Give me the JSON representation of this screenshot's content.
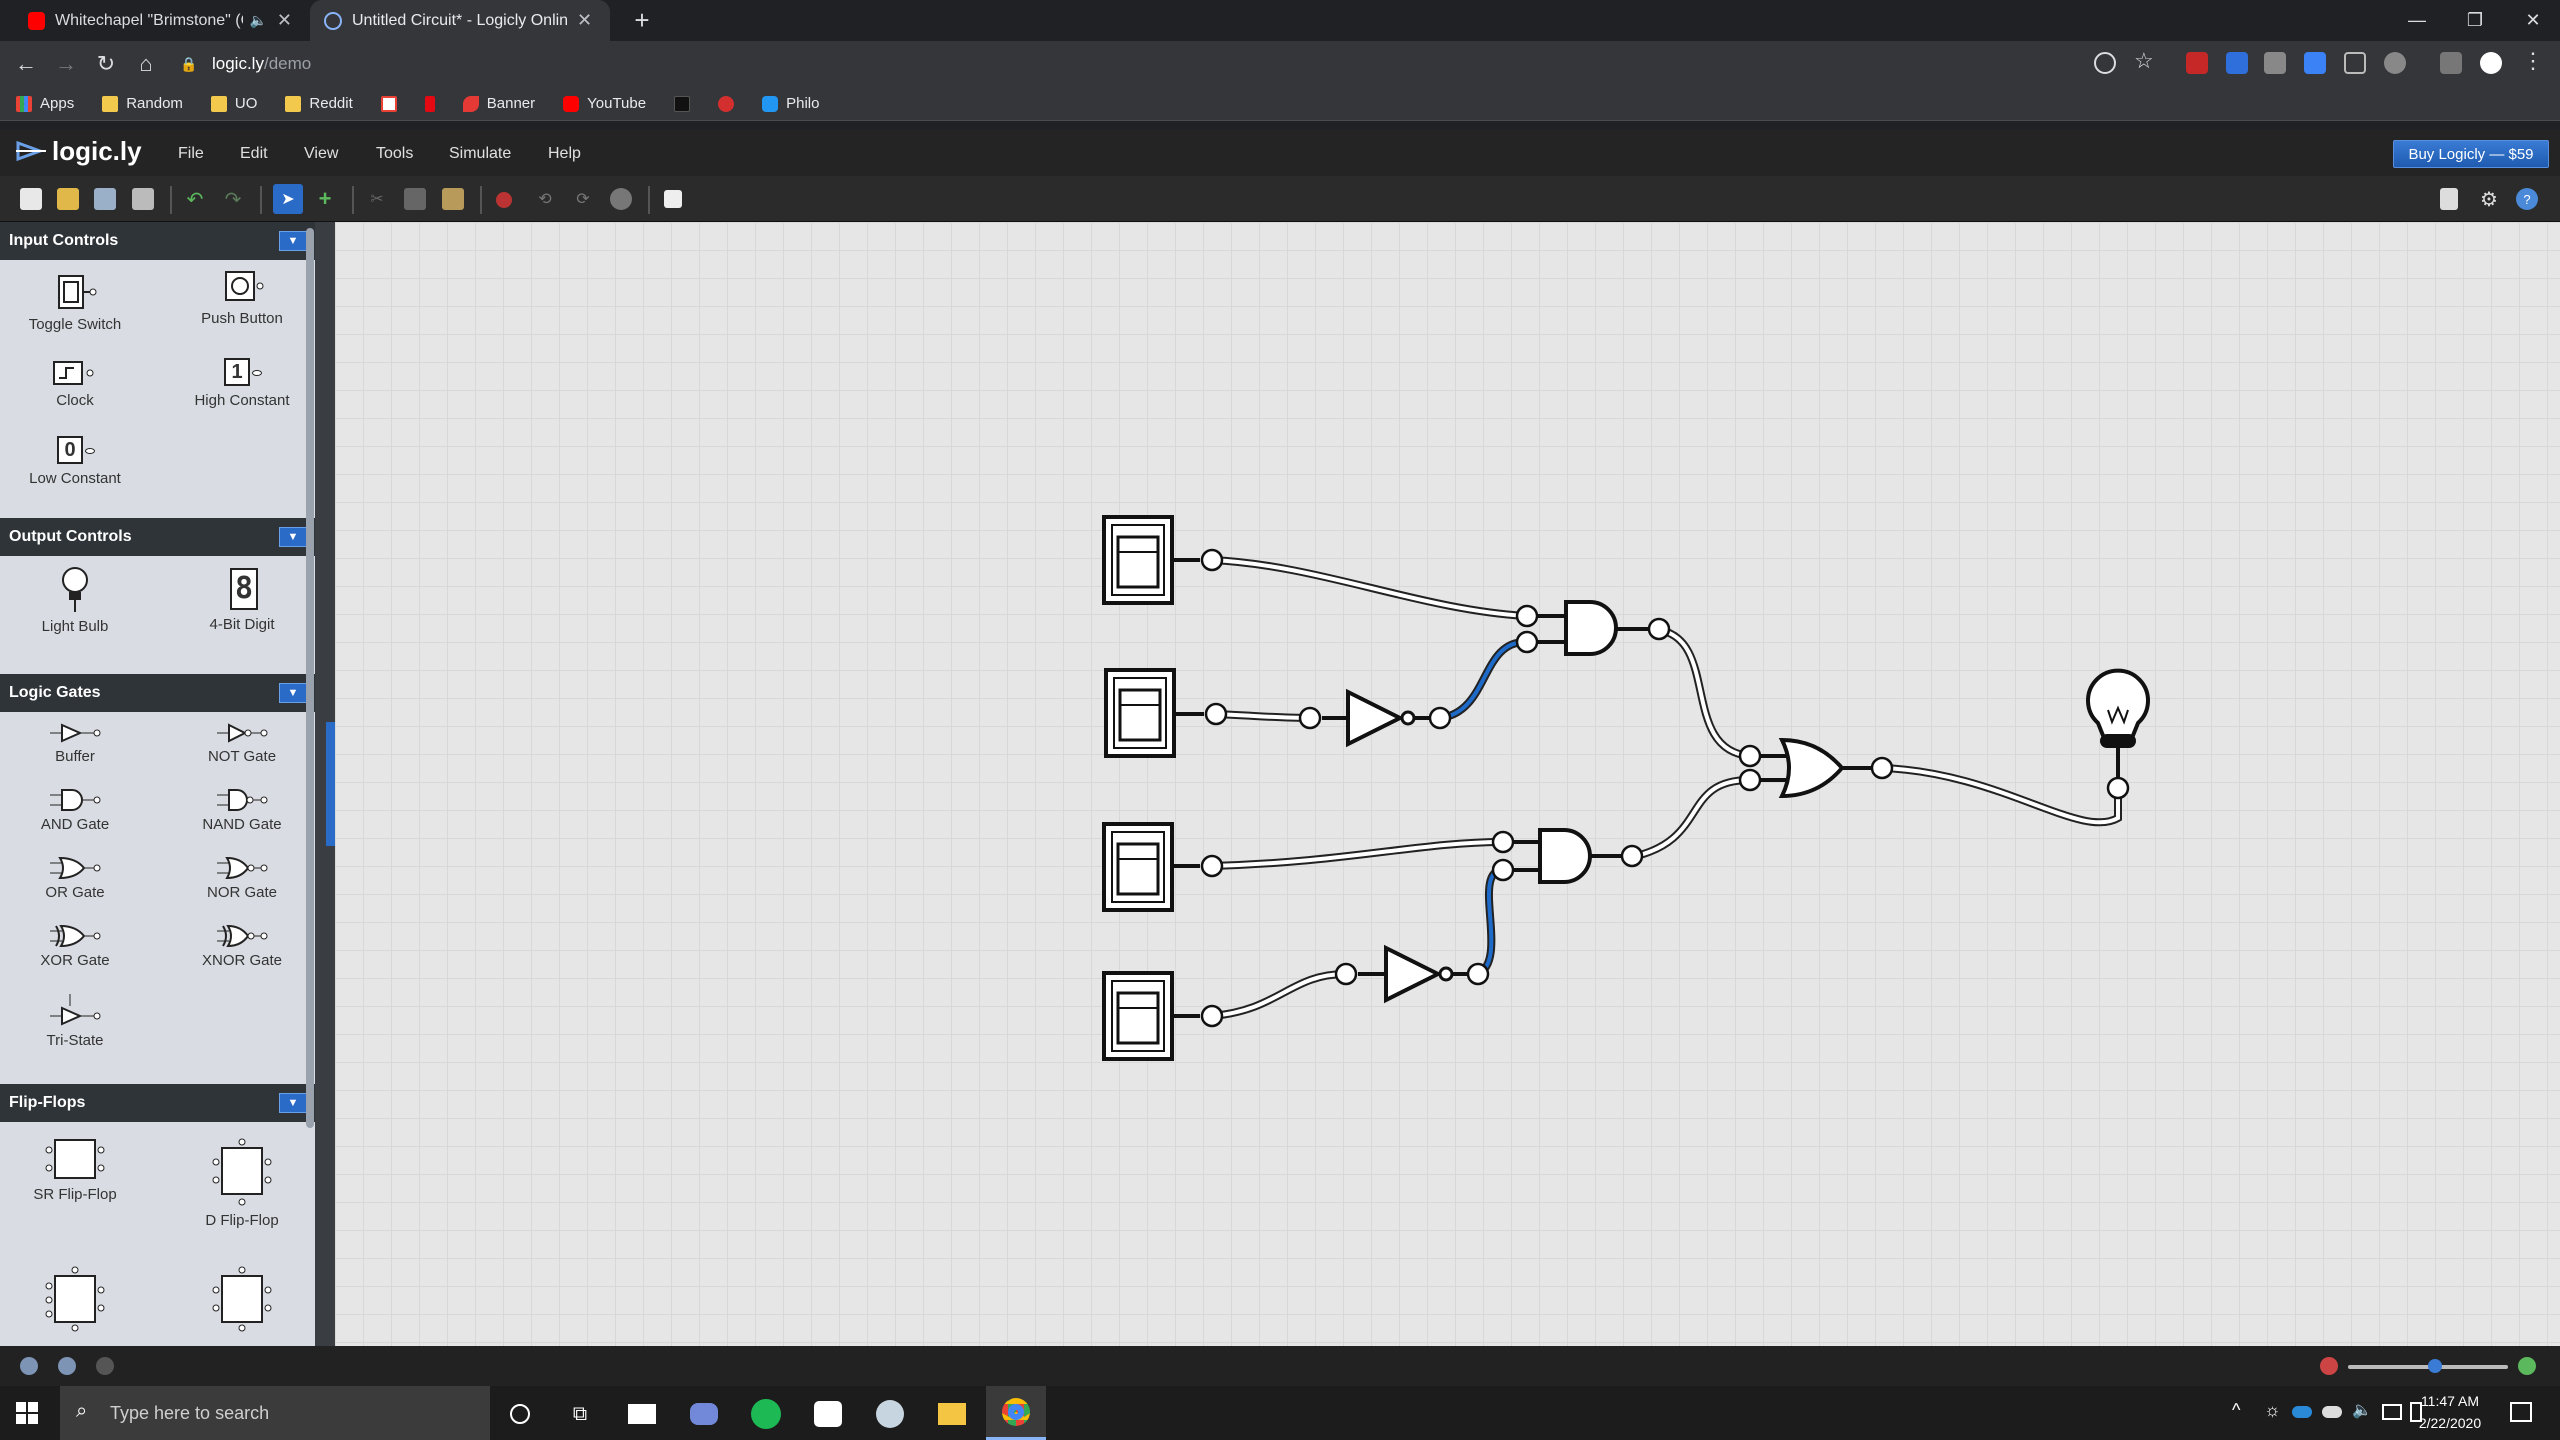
{
  "browser": {
    "tabs": [
      {
        "title": "Whitechapel \"Brimstone\" (OF",
        "active": false
      },
      {
        "title": "Untitled Circuit* - Logicly Online",
        "active": true
      }
    ],
    "url_domain": "logic.ly",
    "url_path": "/demo",
    "bookmarks": [
      "Apps",
      "Random",
      "UO",
      "Reddit",
      "Banner",
      "YouTube",
      "Philo"
    ]
  },
  "app": {
    "logo": "logic.ly",
    "menu": [
      "File",
      "Edit",
      "View",
      "Tools",
      "Simulate",
      "Help"
    ],
    "buy_label": "Buy Logicly — $59"
  },
  "sidebar": {
    "input_controls": {
      "title": "Input Controls",
      "items": [
        "Toggle Switch",
        "Push Button",
        "Clock",
        "High Constant",
        "Low Constant"
      ],
      "high_glyph": "1",
      "low_glyph": "0"
    },
    "output_controls": {
      "title": "Output Controls",
      "items": [
        "Light Bulb",
        "4-Bit Digit"
      ],
      "digit_glyph": "8"
    },
    "logic_gates": {
      "title": "Logic Gates",
      "items": [
        "Buffer",
        "NOT Gate",
        "AND Gate",
        "NAND Gate",
        "OR Gate",
        "NOR Gate",
        "XOR Gate",
        "XNOR Gate",
        "Tri-State"
      ]
    },
    "flip_flops": {
      "title": "Flip-Flops",
      "items": [
        "SR Flip-Flop",
        "D Flip-Flop"
      ]
    }
  },
  "taskbar": {
    "search_placeholder": "Type here to search",
    "time": "11:47 AM",
    "date": "2/22/2020"
  },
  "colors": {
    "active_wire": "#1e6ac8",
    "inactive_wire": "#ffffff",
    "accent": "#2a6bc7"
  }
}
